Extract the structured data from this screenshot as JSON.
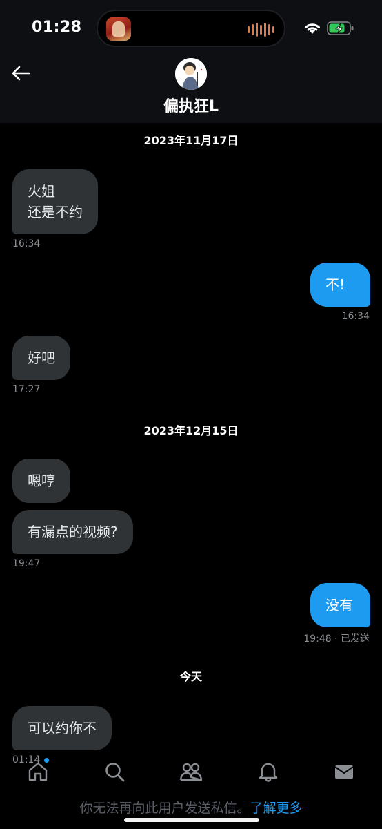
{
  "status_bar": {
    "time": "01:28"
  },
  "header": {
    "contact_name": "偏执狂L"
  },
  "dates": {
    "d1": "2023年11月17日",
    "d2": "2023年12月15日",
    "d3": "今天"
  },
  "messages": [
    {
      "direction": "in",
      "lines": [
        "火姐",
        "还是不约"
      ],
      "time": "16:34"
    },
    {
      "direction": "out",
      "text": "不!",
      "time": "16:34"
    },
    {
      "direction": "in",
      "text": "好吧",
      "time": "17:27"
    },
    {
      "direction": "in",
      "text": "嗯哼"
    },
    {
      "direction": "in",
      "text": "有漏点的视频?",
      "time": "19:47"
    },
    {
      "direction": "out",
      "text": "没有",
      "time": "19:48 · 已发送"
    },
    {
      "direction": "in",
      "text": "可以约你不",
      "time": "01:14"
    }
  ],
  "footer": {
    "notice": "你无法再向此用户发送私信。",
    "link": "了解更多"
  },
  "icons": [
    "back-arrow-icon",
    "home-icon",
    "search-icon",
    "communities-icon",
    "bell-icon",
    "mail-icon",
    "wifi-icon",
    "battery-charging-icon"
  ],
  "colors": {
    "incoming": "#2f3336",
    "outgoing": "#1d9bf0",
    "accent": "#1d9bf0"
  }
}
